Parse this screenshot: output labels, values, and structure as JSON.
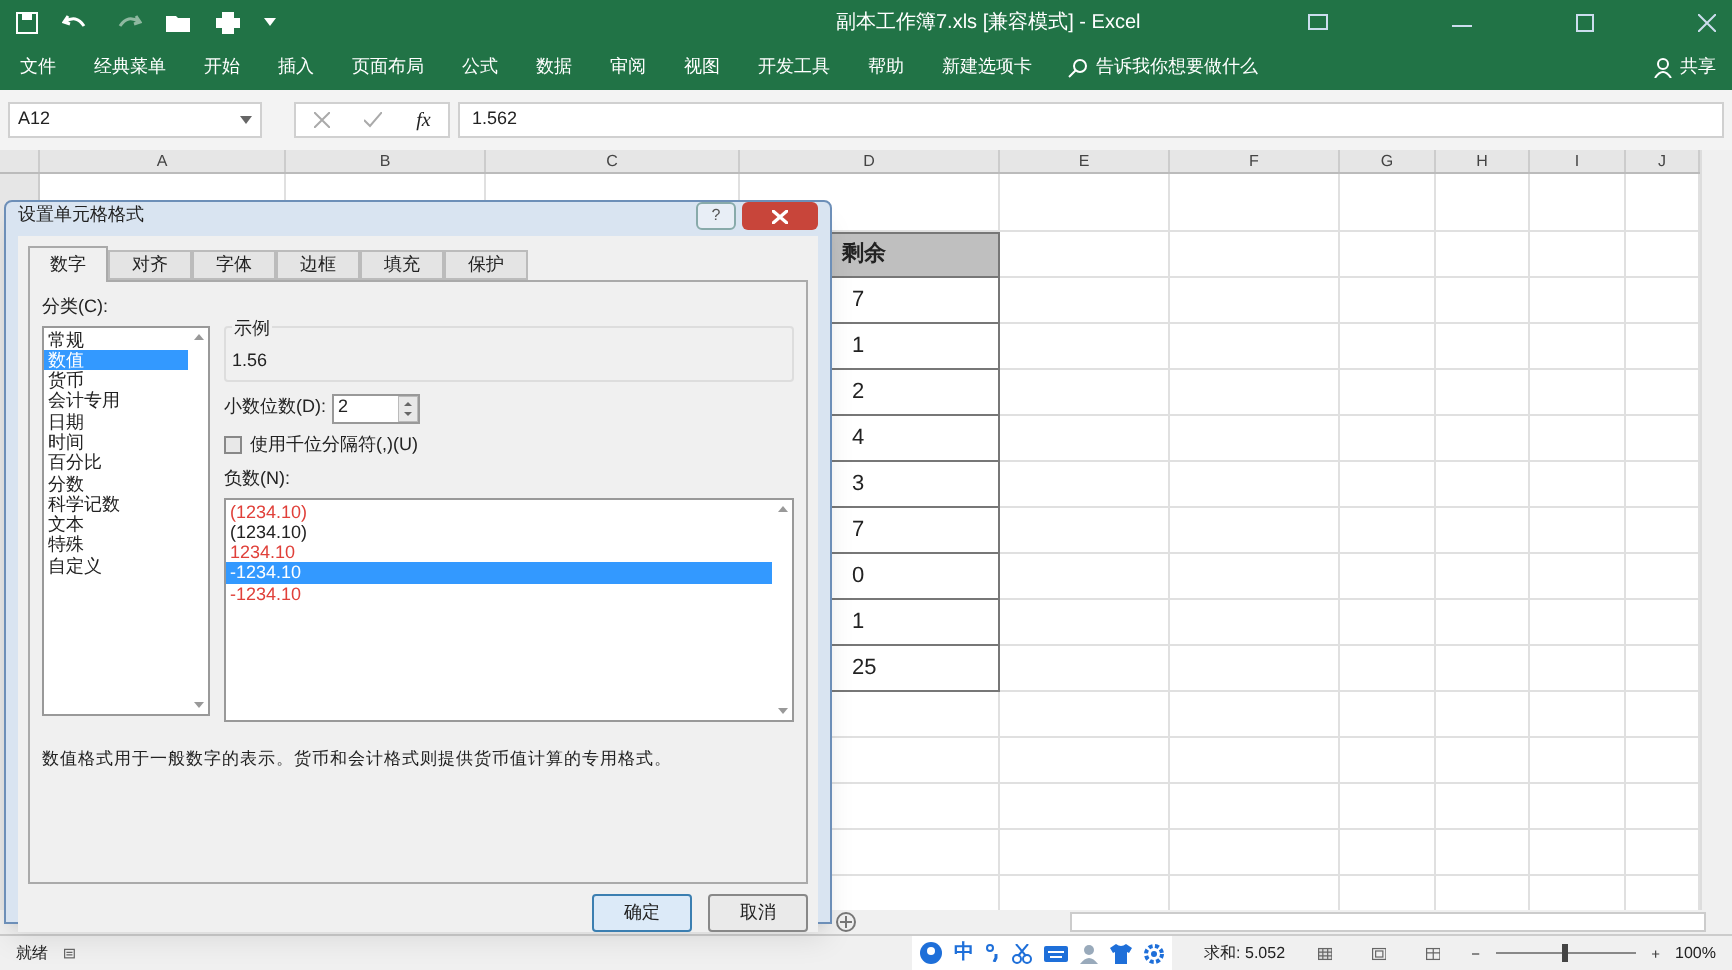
{
  "window": {
    "title": "副本工作簿7.xls  [兼容模式]  -  Excel"
  },
  "ribbon_tabs": [
    {
      "label": "文件"
    },
    {
      "label": "经典菜单"
    },
    {
      "label": "开始"
    },
    {
      "label": "插入"
    },
    {
      "label": "页面布局"
    },
    {
      "label": "公式"
    },
    {
      "label": "数据"
    },
    {
      "label": "审阅"
    },
    {
      "label": "视图"
    },
    {
      "label": "开发工具"
    },
    {
      "label": "帮助"
    },
    {
      "label": "新建选项卡"
    }
  ],
  "tell_me": {
    "placeholder": "告诉我你想要做什么"
  },
  "share": "共享",
  "formula_bar": {
    "name_box": "A12",
    "fx": "fx",
    "value": "1.562"
  },
  "sheet": {
    "columns": [
      "A",
      "B",
      "C",
      "D",
      "E",
      "F",
      "G",
      "H",
      "I",
      "J"
    ],
    "d_cells": [
      {
        "kind": "header",
        "text": "剩余"
      },
      {
        "kind": "value",
        "text": "7"
      },
      {
        "kind": "value",
        "text": "1"
      },
      {
        "kind": "value",
        "text": "2"
      },
      {
        "kind": "value",
        "text": "4"
      },
      {
        "kind": "value",
        "text": "3"
      },
      {
        "kind": "value",
        "text": "7"
      },
      {
        "kind": "value",
        "text": "0"
      },
      {
        "kind": "value",
        "text": "1"
      },
      {
        "kind": "value",
        "text": "25"
      }
    ]
  },
  "dialog": {
    "title": "设置单元格格式",
    "help": "?",
    "tabs": [
      {
        "label": "数字",
        "selected": true
      },
      {
        "label": "对齐",
        "selected": false
      },
      {
        "label": "字体",
        "selected": false
      },
      {
        "label": "边框",
        "selected": false
      },
      {
        "label": "填充",
        "selected": false
      },
      {
        "label": "保护",
        "selected": false
      }
    ],
    "category_label": "分类(C):",
    "categories": [
      {
        "label": "常规",
        "selected": false
      },
      {
        "label": "数值",
        "selected": true
      },
      {
        "label": "货币",
        "selected": false
      },
      {
        "label": "会计专用",
        "selected": false
      },
      {
        "label": "日期",
        "selected": false
      },
      {
        "label": "时间",
        "selected": false
      },
      {
        "label": "百分比",
        "selected": false
      },
      {
        "label": "分数",
        "selected": false
      },
      {
        "label": "科学记数",
        "selected": false
      },
      {
        "label": "文本",
        "selected": false
      },
      {
        "label": "特殊",
        "selected": false
      },
      {
        "label": "自定义",
        "selected": false
      }
    ],
    "sample_label": "示例",
    "sample_value": "1.56",
    "decimals_label": "小数位数(D):",
    "decimals_value": "2",
    "thousands": {
      "label": "使用千位分隔符(,)(U)",
      "checked": false
    },
    "negative_label": "负数(N):",
    "negatives": [
      {
        "label": "(1234.10)",
        "kind": "red",
        "selected": false
      },
      {
        "label": "(1234.10)",
        "kind": "plain",
        "selected": false
      },
      {
        "label": "1234.10",
        "kind": "red",
        "selected": false
      },
      {
        "label": "-1234.10",
        "kind": "plain",
        "selected": true
      },
      {
        "label": "-1234.10",
        "kind": "red",
        "selected": false
      }
    ],
    "description": "数值格式用于一般数字的表示。货币和会计格式则提供货币值计算的专用格式。",
    "buttons": [
      {
        "label": "确定",
        "kind": "default"
      },
      {
        "label": "取消",
        "kind": "normal"
      }
    ]
  },
  "status_bar": {
    "ready": "就绪",
    "ime": "中",
    "sum": "求和: 5.052",
    "zoom": {
      "level": 0.5,
      "reading": "100%"
    }
  }
}
